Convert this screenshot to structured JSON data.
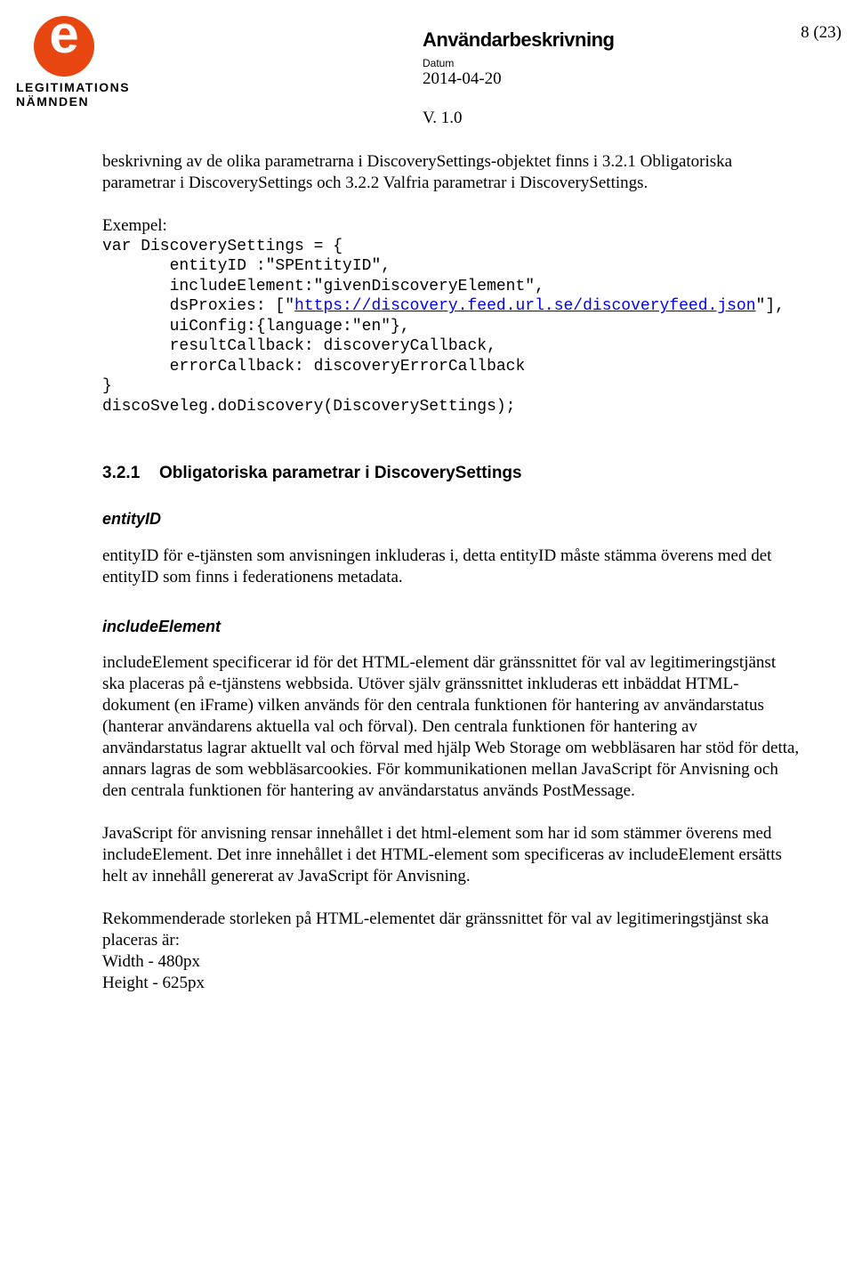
{
  "header": {
    "logo_line1": "LEGITIMATIONS",
    "logo_line2": "NÄMNDEN",
    "doc_type": "Användarbeskrivning",
    "datum_label": "Datum",
    "datum_value": "2014-04-20",
    "version": "V. 1.0",
    "page_num": "8 (23)"
  },
  "body": {
    "intro1": "beskrivning av de olika parametrarna i DiscoverySettings-objektet finns i 3.2.1 Obligatoriska parametrar i DiscoverySettings och 3.2.2 Valfria parametrar i DiscoverySettings.",
    "exempel_label": "Exempel:",
    "code": {
      "l1": "var DiscoverySettings = {",
      "l2": "       entityID :\"SPEntityID\",",
      "l3": "       includeElement:\"givenDiscoveryElement\",",
      "l4a": "       dsProxies: [\"",
      "l4_link": "https://discovery.feed.url.se/discoveryfeed.json",
      "l4b": "\"],",
      "l5": "       uiConfig:{language:\"en\"},",
      "l6": "       resultCallback: discoveryCallback,",
      "l7": "       errorCallback: discoveryErrorCallback",
      "l8": "}",
      "l9": "discoSveleg.doDiscovery(DiscoverySettings);"
    },
    "h3_num": "3.2.1",
    "h3_text": "Obligatoriska parametrar i DiscoverySettings",
    "entityID_head": "entityID",
    "entityID_text": "entityID för e-tjänsten som anvisningen inkluderas i, detta entityID måste stämma överens med det entityID som finns i federationens metadata.",
    "includeElement_head": "includeElement",
    "includeElement_p1": "includeElement specificerar id för det HTML-element där gränssnittet för val av legitimeringstjänst ska placeras på e-tjänstens webbsida. Utöver själv gränssnittet inkluderas ett inbäddat HTML-dokument (en iFrame) vilken används för den centrala funktionen för hantering av användarstatus (hanterar användarens aktuella val och förval). Den centrala funktionen för hantering av användarstatus lagrar aktuellt val och förval med hjälp Web Storage om webbläsaren har stöd för detta, annars lagras de som webbläsarcookies. För kommunikationen mellan JavaScript för Anvisning och den centrala funktionen för hantering av användarstatus används PostMessage.",
    "includeElement_p2": "JavaScript för anvisning rensar innehållet i det html-element som har id som stämmer överens med includeElement. Det inre innehållet i det HTML-element som specificeras av includeElement ersätts helt av innehåll genererat av JavaScript för Anvisning.",
    "includeElement_p3": "Rekommenderade storleken på HTML-elementet där gränssnittet för val av legitimeringstjänst ska placeras är:",
    "width_line": "Width - 480px",
    "height_line": "Height - 625px"
  }
}
